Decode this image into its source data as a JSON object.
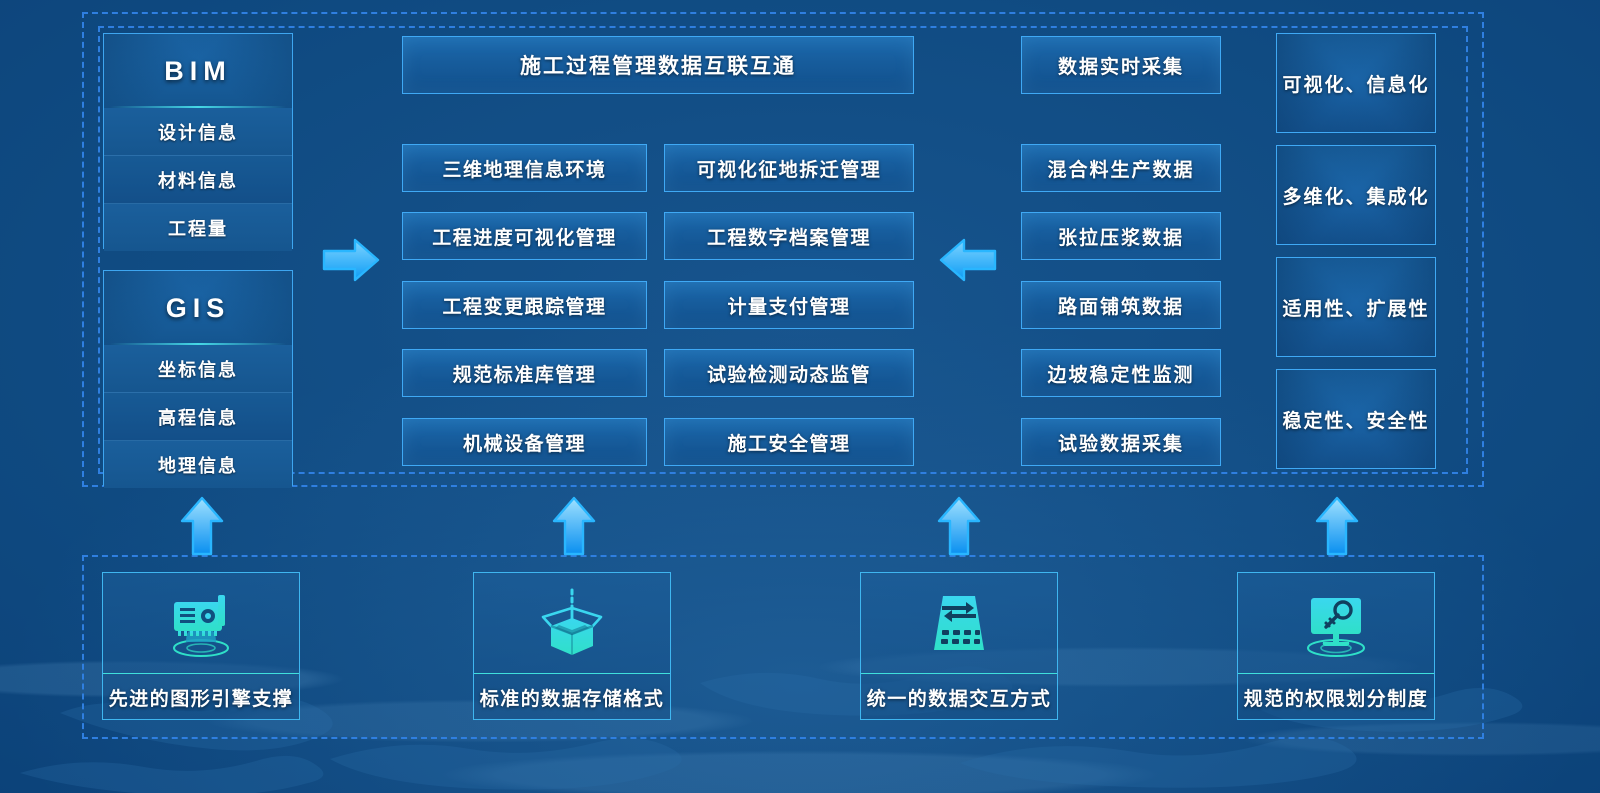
{
  "colors": {
    "accent": "#3fa9f5",
    "dashed_border": "#2f7fe0",
    "background_deep": "#0b4077",
    "background_mid": "#17548d",
    "icon_cyan": "#3fe0dc",
    "divider_cyan": "#46d8e6"
  },
  "left_column": {
    "stacks": [
      {
        "title": "BIM",
        "items": [
          "设计信息",
          "材料信息",
          "工程量"
        ]
      },
      {
        "title": "GIS",
        "items": [
          "坐标信息",
          "高程信息",
          "地理信息"
        ]
      }
    ]
  },
  "center_column": {
    "header": "施工过程管理数据互联互通",
    "grid": [
      [
        "三维地理信息环境",
        "可视化征地拆迁管理"
      ],
      [
        "工程进度可视化管理",
        "工程数字档案管理"
      ],
      [
        "工程变更跟踪管理",
        "计量支付管理"
      ],
      [
        "规范标准库管理",
        "试验检测动态监管"
      ],
      [
        "机械设备管理",
        "施工安全管理"
      ]
    ]
  },
  "data_column": {
    "items": [
      "数据实时采集",
      "混合料生产数据",
      "张拉压浆数据",
      "路面铺筑数据",
      "边坡稳定性监测",
      "试验数据采集"
    ]
  },
  "feature_column": {
    "items": [
      "可视化、信息化",
      "多维化、集成化",
      "适用性、扩展性",
      "稳定性、安全性"
    ]
  },
  "foundation": {
    "cards": [
      {
        "label": "先进的图形引擎支撑",
        "icon": "graphics-card-icon"
      },
      {
        "label": "标准的数据存储格式",
        "icon": "open-box-icon"
      },
      {
        "label": "统一的数据交互方式",
        "icon": "data-exchange-icon"
      },
      {
        "label": "规范的权限划分制度",
        "icon": "monitor-key-icon"
      }
    ]
  },
  "arrows": {
    "right_arrow": "arrow-right-icon",
    "left_arrow": "arrow-left-icon",
    "up_arrow": "arrow-up-icon",
    "up_arrow_count": 4
  }
}
